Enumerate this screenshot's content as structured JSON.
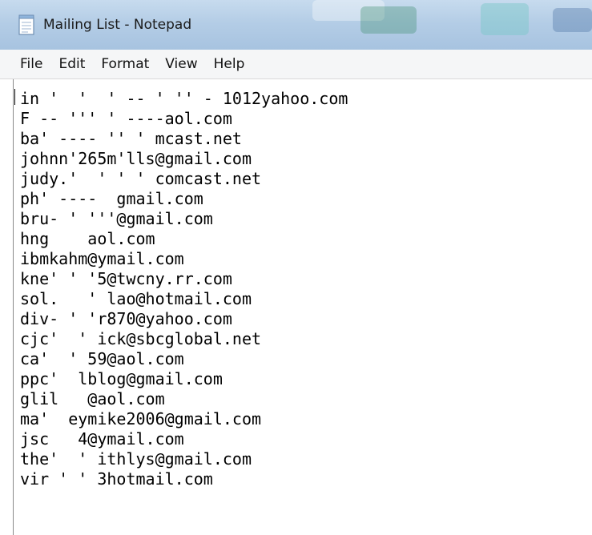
{
  "window": {
    "title": "Mailing List - Notepad"
  },
  "icons": {
    "app": "notepad-icon"
  },
  "colors": {
    "titlebar": "#b4cde6",
    "menubar": "#f5f6f7",
    "text": "#000000"
  },
  "menu": {
    "items": [
      "File",
      "Edit",
      "Format",
      "View",
      "Help"
    ]
  },
  "document": {
    "lines": [
      "in '  '  ' -- ' '' - 1012yahoo.com",
      "F -- ''' ' ----aol.com",
      "ba' ---- '' ' mcast.net",
      "johnn'265m'lls@gmail.com",
      "judy.'  ' ' ' comcast.net",
      "ph' ----  gmail.com",
      "bru- ' '''@gmail.com",
      "hng    aol.com",
      "ibmkahm@ymail.com",
      "kne' ' '5@twcny.rr.com",
      "sol.   ' lao@hotmail.com",
      "div- ' 'r870@yahoo.com",
      "cjc'  ' ick@sbcglobal.net",
      "ca'  ' 59@aol.com",
      "ppc'  lblog@gmail.com",
      "glil   @aol.com",
      "ma'  eymike2006@gmail.com",
      "jsc   4@ymail.com",
      "the'  ' ithlys@gmail.com",
      "vir ' ' 3hotmail.com"
    ]
  }
}
